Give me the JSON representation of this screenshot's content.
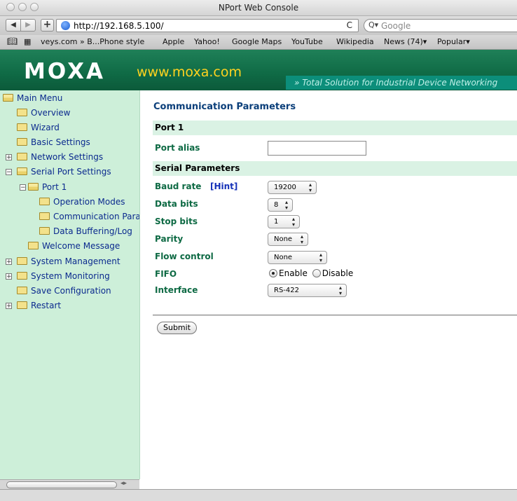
{
  "window": {
    "title": "NPort Web Console"
  },
  "toolbar": {
    "back": "◀",
    "forward": "▶",
    "add": "+",
    "url": "http://192.168.5.100/",
    "reload": "C",
    "search_placeholder": "Google"
  },
  "bookmarks": [
    "veys.com » B...Phone style",
    "Apple",
    "Yahoo!",
    "Google Maps",
    "YouTube",
    "Wikipedia",
    "News (74)▾",
    "Popular▾"
  ],
  "banner": {
    "logo": "MOXA",
    "site": "www.moxa.com",
    "slogan": "» Total Solution for Industrial Device Networking"
  },
  "sidebar": {
    "main": "Main Menu",
    "overview": "Overview",
    "wizard": "Wizard",
    "basic": "Basic Settings",
    "network": "Network Settings",
    "serial": "Serial Port Settings",
    "port1": "Port 1",
    "opmodes": "Operation Modes",
    "comm": "Communication Parameters",
    "buffer": "Data Buffering/Log",
    "welcome": "Welcome Message",
    "sysmgmt": "System Management",
    "sysmon": "System Monitoring",
    "save": "Save Configuration",
    "restart": "Restart"
  },
  "content": {
    "title": "Communication Parameters",
    "port_section": "Port 1",
    "port_alias_label": "Port alias",
    "port_alias_value": "",
    "serial_section": "Serial Parameters",
    "baud_label": "Baud rate",
    "hint": "[Hint]",
    "baud_value": "19200",
    "databits_label": "Data bits",
    "databits_value": "8",
    "stopbits_label": "Stop bits",
    "stopbits_value": "1",
    "parity_label": "Parity",
    "parity_value": "None",
    "flow_label": "Flow control",
    "flow_value": "None",
    "fifo_label": "FIFO",
    "fifo_enable": "Enable",
    "fifo_disable": "Disable",
    "interface_label": "Interface",
    "interface_value": "RS-422",
    "submit": "Submit"
  }
}
